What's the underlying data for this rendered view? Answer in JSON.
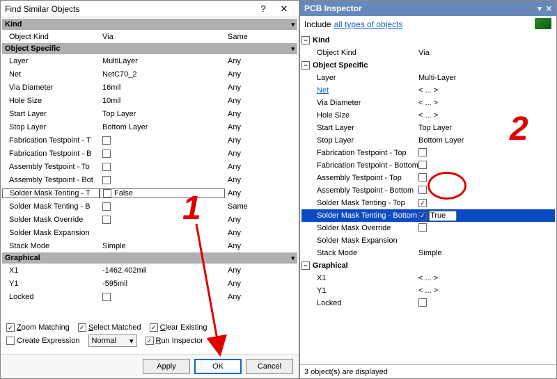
{
  "dialog": {
    "title": "Find Similar Objects",
    "sections": {
      "kind": {
        "title": "Kind",
        "rows": [
          {
            "label": "Object Kind",
            "value": "Via",
            "scope": "Same"
          }
        ]
      },
      "object_specific": {
        "title": "Object Specific",
        "rows": [
          {
            "label": "Layer",
            "value": "MultiLayer",
            "scope": "Any"
          },
          {
            "label": "Net",
            "value": "NetC70_2",
            "scope": "Any"
          },
          {
            "label": "Via Diameter",
            "value": "16mil",
            "scope": "Any"
          },
          {
            "label": "Hole Size",
            "value": "10mil",
            "scope": "Any"
          },
          {
            "label": "Start Layer",
            "value": "Top Layer",
            "scope": "Any"
          },
          {
            "label": "Stop Layer",
            "value": "Bottom Layer",
            "scope": "Any"
          },
          {
            "label": "Fabrication Testpoint - T",
            "value": "",
            "scope": "Any",
            "chk": true
          },
          {
            "label": "Fabrication Testpoint - B",
            "value": "",
            "scope": "Any",
            "chk": true
          },
          {
            "label": "Assembly Testpoint - To",
            "value": "",
            "scope": "Any",
            "chk": true
          },
          {
            "label": "Assembly Testpoint - Bot",
            "value": "",
            "scope": "Any",
            "chk": true
          },
          {
            "label": "Solder Mask Tenting - T",
            "value": "False",
            "scope": "Any",
            "chk": true,
            "selected": true
          },
          {
            "label": "Solder Mask Tenting - B",
            "value": "",
            "scope": "Same",
            "chk": true
          },
          {
            "label": "Solder Mask Override",
            "value": "",
            "scope": "Any",
            "chk": true
          },
          {
            "label": "Solder Mask Expansion",
            "value": "",
            "scope": "Any"
          },
          {
            "label": "Stack Mode",
            "value": "Simple",
            "scope": "Any"
          }
        ]
      },
      "graphical": {
        "title": "Graphical",
        "rows": [
          {
            "label": "X1",
            "value": "-1462.402mil",
            "scope": "Any"
          },
          {
            "label": "Y1",
            "value": "-595mil",
            "scope": "Any"
          },
          {
            "label": "Locked",
            "value": "",
            "scope": "Any",
            "chk": true
          }
        ]
      }
    },
    "options": {
      "zoom": {
        "label_pre": "Z",
        "label_post": "oom Matching",
        "checked": true
      },
      "select": {
        "label_pre": "S",
        "label_post": "elect Matched",
        "checked": true
      },
      "clear": {
        "label_pre": "C",
        "label_post": "lear Existing",
        "checked": true
      },
      "create_expr": {
        "label": "Create Expression",
        "checked": false
      },
      "mode": "Normal",
      "run_insp": {
        "label_pre": "R",
        "label_post": "un Inspector",
        "checked": true
      }
    },
    "buttons": {
      "apply": "Apply",
      "ok": "OK",
      "cancel": "Cancel"
    }
  },
  "inspector": {
    "title": "PCB Inspector",
    "include_label": "Include",
    "include_link": "all types of objects",
    "sections": {
      "kind": {
        "title": "Kind",
        "rows": [
          {
            "label": "Object Kind",
            "value": "Via"
          }
        ]
      },
      "object_specific": {
        "title": "Object Specific",
        "rows": [
          {
            "label": "Layer",
            "value": "Multi-Layer"
          },
          {
            "label": "Net",
            "value": "< ... >",
            "link": true
          },
          {
            "label": "Via Diameter",
            "value": "< ... >"
          },
          {
            "label": "Hole Size",
            "value": "< ... >"
          },
          {
            "label": "Start Layer",
            "value": "Top Layer"
          },
          {
            "label": "Stop Layer",
            "value": "Bottom Layer"
          },
          {
            "label": "Fabrication Testpoint - Top",
            "value": "",
            "chk": true,
            "checked": false
          },
          {
            "label": "Fabrication Testpoint - Bottom",
            "value": "",
            "chk": true,
            "checked": false
          },
          {
            "label": "Assembly Testpoint - Top",
            "value": "",
            "chk": true,
            "checked": false
          },
          {
            "label": "Assembly Testpoint - Bottom",
            "value": "",
            "chk": true,
            "checked": false
          },
          {
            "label": "Solder Mask Tenting - Top",
            "value": "",
            "chk": true,
            "checked": true
          },
          {
            "label": "Solder Mask Tenting - Bottom",
            "value": "True",
            "chk": true,
            "checked": true,
            "highlight": true
          },
          {
            "label": "Solder Mask Override",
            "value": "",
            "chk": true,
            "checked": false
          },
          {
            "label": "Solder Mask Expansion",
            "value": ""
          },
          {
            "label": "Stack Mode",
            "value": "Simple"
          }
        ]
      },
      "graphical": {
        "title": "Graphical",
        "rows": [
          {
            "label": "X1",
            "value": "< ... >"
          },
          {
            "label": "Y1",
            "value": "< ... >"
          },
          {
            "label": "Locked",
            "value": "",
            "chk": true,
            "checked": false
          }
        ]
      }
    },
    "status": "3 object(s) are displayed"
  },
  "annotations": {
    "one": "1",
    "two": "2"
  }
}
